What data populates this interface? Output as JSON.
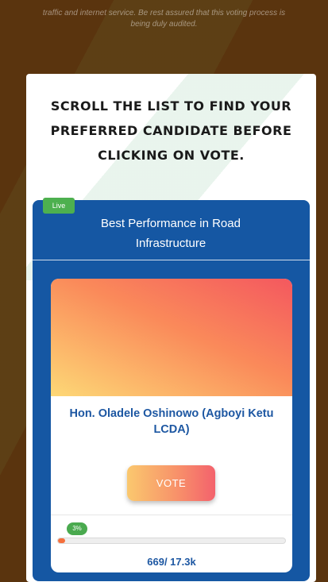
{
  "header": {
    "note_line1": "traffic and internet service. Be rest assured that this voting process is",
    "note_line2": "being duly audited."
  },
  "instructions": {
    "line1": "SCROLL THE LIST TO FIND YOUR",
    "line2": "PREFERRED CANDIDATE BEFORE",
    "line3": "CLICKING ON VOTE."
  },
  "category": {
    "badge": "Live",
    "title_line1": "Best Performance in Road",
    "title_line2": "Infrastructure"
  },
  "candidate": {
    "name_line1": "Hon. Oladele Oshinowo (Agboyi Ketu",
    "name_line2": "LCDA)",
    "vote_label": "VOTE",
    "percent_label": "3%",
    "progress_fraction": 0.03,
    "votes": "669/ 17.3k"
  },
  "colors": {
    "background": "#5a340e",
    "panel": "#1557a3",
    "live_badge": "#4db04f",
    "name_text": "#1d57a2",
    "progress_fill": "#f56f3c"
  }
}
